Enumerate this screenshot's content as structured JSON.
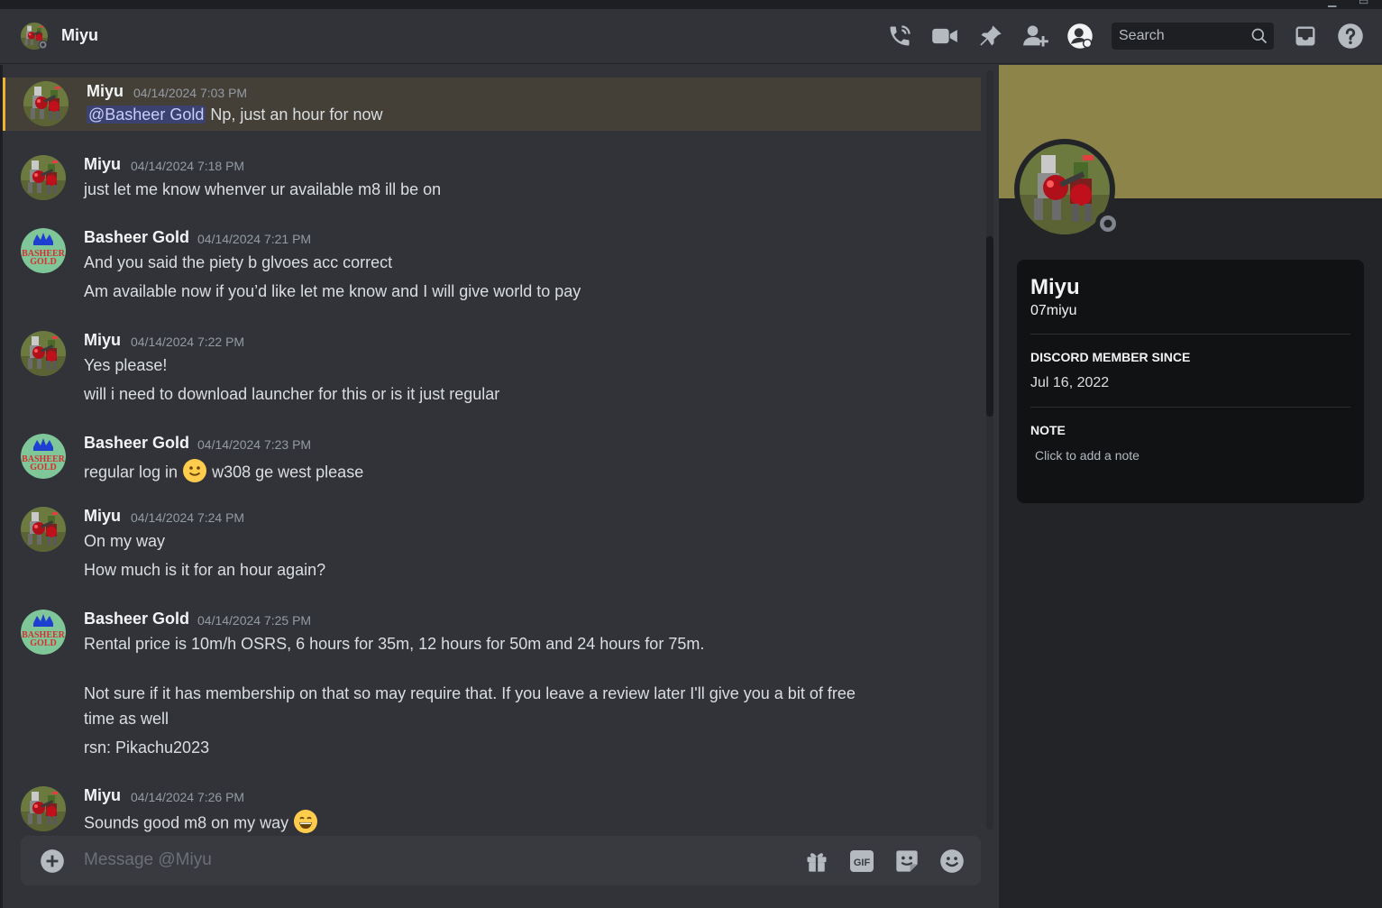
{
  "header": {
    "title": "Miyu",
    "search_placeholder": "Search"
  },
  "messages": [
    {
      "author": "Miyu",
      "time": "04/14/2024 7:03 PM",
      "mention": "@Basheer Gold",
      "lines": [
        "Np, just an hour for now"
      ]
    },
    {
      "author": "Miyu",
      "time": "04/14/2024 7:18 PM",
      "lines": [
        "just let me know whenver ur available m8 ill be on"
      ]
    },
    {
      "author": "Basheer Gold",
      "time": "04/14/2024 7:21 PM",
      "lines": [
        "And you said the piety b glvoes acc correct",
        "Am available now if you’d like let me know and I will give world to pay"
      ]
    },
    {
      "author": "Miyu",
      "time": "04/14/2024 7:22 PM",
      "lines": [
        "Yes please!",
        "will i need to download launcher for this or is it just regular"
      ]
    },
    {
      "author": "Basheer Gold",
      "time": "04/14/2024 7:23 PM",
      "lines": [
        "regular log in",
        "w308 ge west please"
      ]
    },
    {
      "author": "Miyu",
      "time": "04/14/2024 7:24 PM",
      "lines": [
        "On my way",
        "How much is it for an hour again?"
      ]
    },
    {
      "author": "Basheer Gold",
      "time": "04/14/2024 7:25 PM",
      "lines": [
        "Rental price is 10m/h OSRS, 6 hours for 35m, 12 hours for 50m and 24 hours for 75m.",
        "Not sure if it has membership on that so may require that.  If you leave a review later I'll give you a bit of free",
        "time as well",
        "rsn: Pikachu2023"
      ]
    },
    {
      "author": "Miyu",
      "time": "04/14/2024 7:26 PM",
      "lines": [
        "Sounds good m8 on my way"
      ]
    }
  ],
  "avatar_labels": {
    "basheer_line1": "BASHEER",
    "basheer_line2": "GOLD"
  },
  "composer": {
    "placeholder": "Message @Miyu",
    "gif_label": "GIF"
  },
  "profile": {
    "display_name": "Miyu",
    "username": "07miyu",
    "member_since_heading": "DISCORD MEMBER SINCE",
    "member_since": "Jul 16, 2022",
    "note_heading": "NOTE",
    "note_placeholder": "Click to add a note"
  },
  "icons": {
    "header": [
      "phone-call-icon",
      "video-camera-icon",
      "pin-icon",
      "add-friend-icon",
      "user-profile-icon",
      "search-icon",
      "inbox-icon",
      "help-icon"
    ],
    "composer": [
      "add-plus-icon",
      "gift-icon",
      "gif-icon",
      "sticker-icon",
      "emoji-icon"
    ]
  },
  "colors": {
    "background": "#313338",
    "panel": "#232428",
    "banner": "#8c8448",
    "mention_highlight": "#444037",
    "mention_bar": "#f0b232",
    "mention_pill": "#3c4270"
  }
}
